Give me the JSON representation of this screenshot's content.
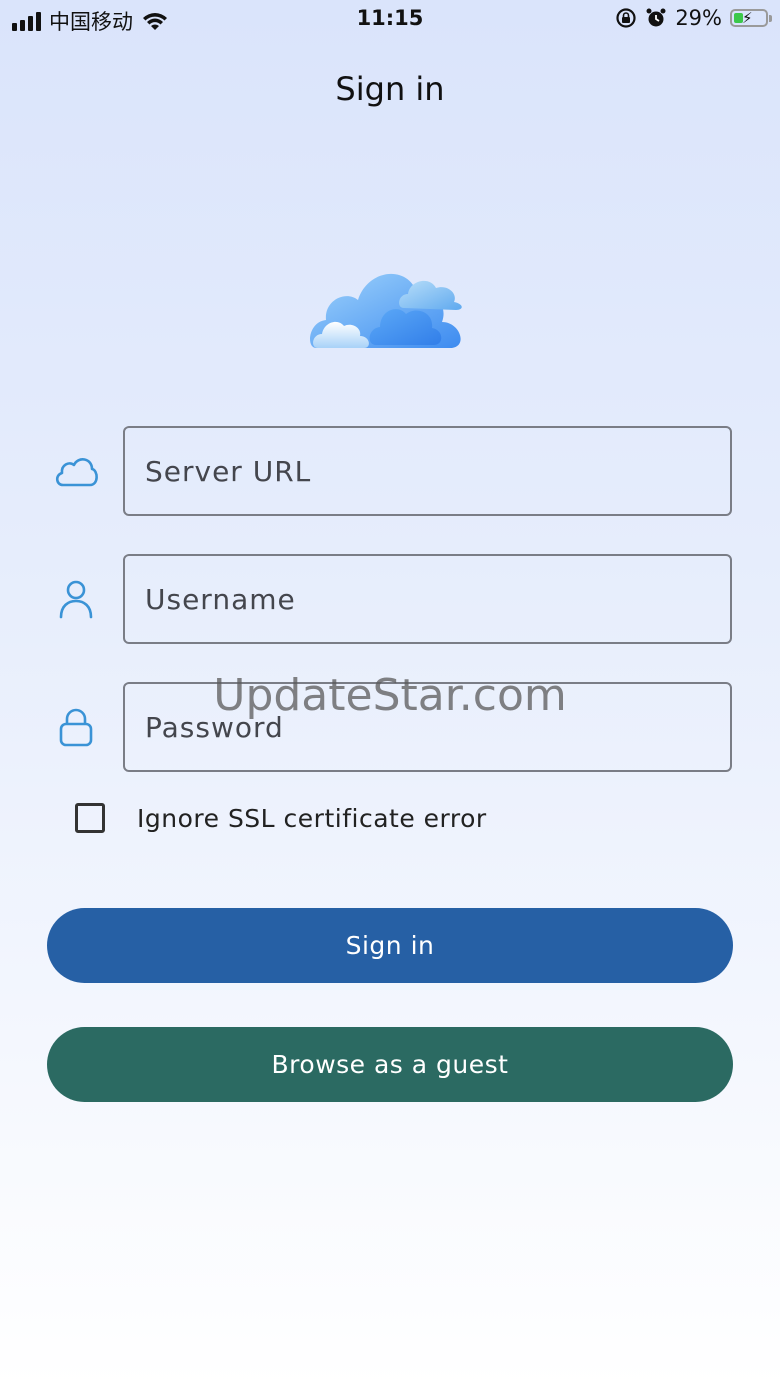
{
  "status_bar": {
    "carrier": "中国移动",
    "time": "11:15",
    "battery_percent": "29%",
    "battery_level": 0.29,
    "signal_icon": "signal-bars-icon",
    "wifi_icon": "wifi-icon",
    "rotation_lock_icon": "rotation-lock-icon",
    "alarm_icon": "alarm-icon",
    "battery_icon": "battery-charging-icon"
  },
  "header": {
    "title": "Sign in"
  },
  "logo": {
    "icon": "cloud-logo-icon"
  },
  "form": {
    "server_url": {
      "icon": "cloud-icon",
      "placeholder": "Server URL",
      "value": ""
    },
    "username": {
      "icon": "user-icon",
      "placeholder": "Username",
      "value": ""
    },
    "password": {
      "icon": "lock-icon",
      "placeholder": "Password",
      "value": ""
    },
    "ignore_ssl": {
      "label": "Ignore SSL certificate error",
      "checked": false
    }
  },
  "actions": {
    "sign_in_label": "Sign in",
    "guest_label": "Browse as a guest"
  },
  "watermark": "UpdateStar.com",
  "colors": {
    "accent_icon": "#3a93d6",
    "sign_in_button": "#2660a5",
    "guest_button": "#2b6a62",
    "battery_fill": "#3cc84a"
  }
}
